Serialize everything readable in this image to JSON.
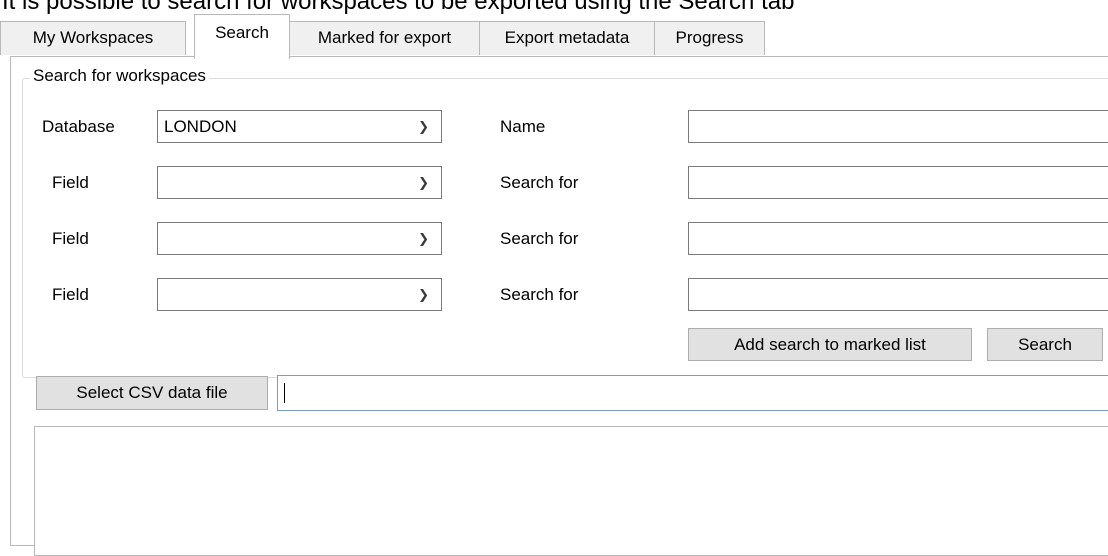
{
  "caption": "It is possible to search for workspaces to be exported using the Search tab",
  "tabs": [
    {
      "label": "My Workspaces",
      "active": false
    },
    {
      "label": "Search",
      "active": true
    },
    {
      "label": "Marked for export",
      "active": false
    },
    {
      "label": "Export metadata",
      "active": false
    },
    {
      "label": "Progress",
      "active": false
    }
  ],
  "search_group": {
    "title": "Search for workspaces",
    "database_label": "Database",
    "database_value": "LONDON",
    "name_label": "Name",
    "name_value": "",
    "criteria": [
      {
        "field_label": "Field",
        "field_value": "",
        "search_label": "Search for",
        "search_value": ""
      },
      {
        "field_label": "Field",
        "field_value": "",
        "search_label": "Search for",
        "search_value": ""
      },
      {
        "field_label": "Field",
        "field_value": "",
        "search_label": "Search for",
        "search_value": ""
      }
    ],
    "add_to_marked_label": "Add search to marked list",
    "search_button_label": "Search"
  },
  "csv": {
    "select_button_label": "Select CSV data file",
    "path_value": ""
  },
  "icons": {
    "dropdown": "chevron-down-icon"
  }
}
